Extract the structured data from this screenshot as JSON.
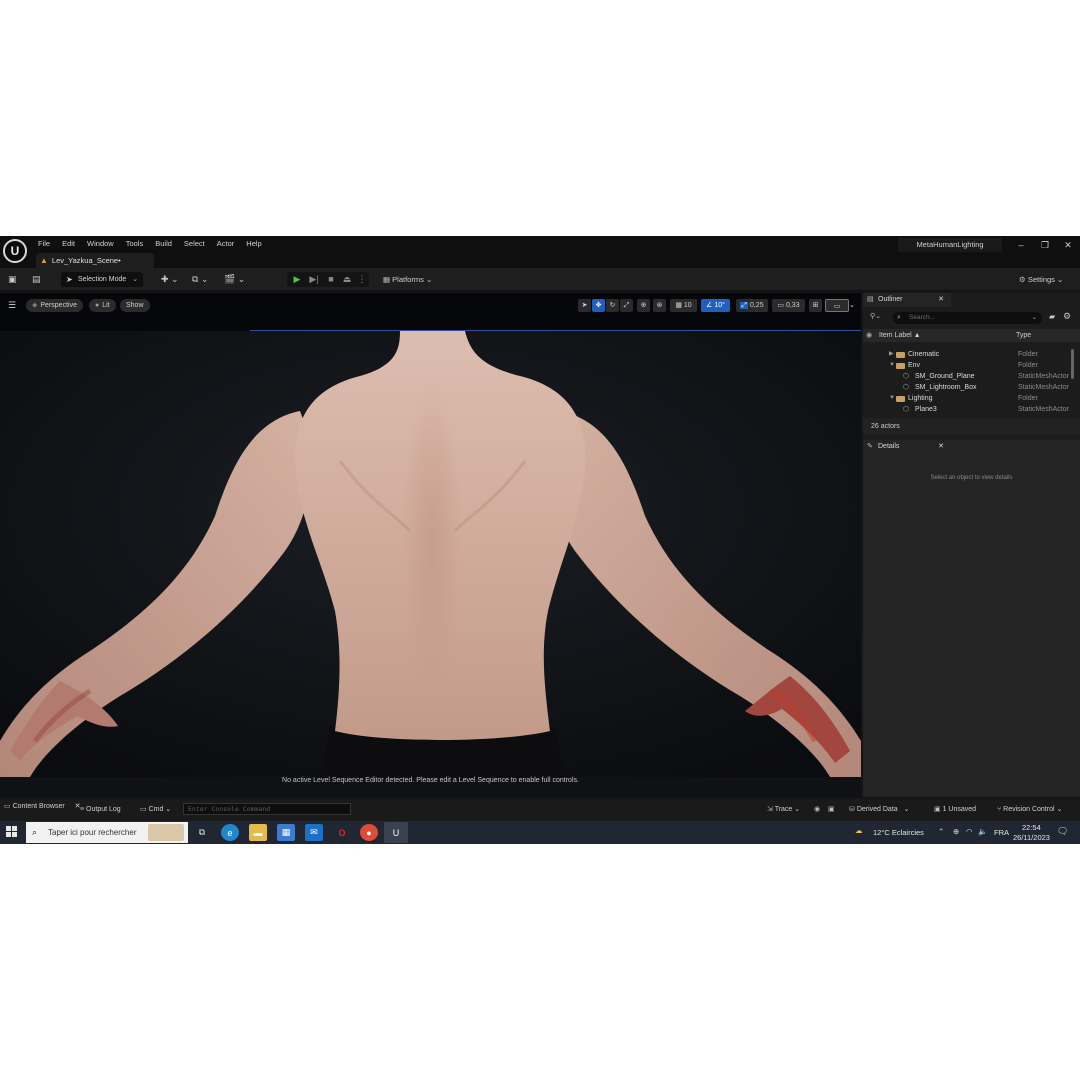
{
  "titlebar": {
    "menu": [
      "File",
      "Edit",
      "Window",
      "Tools",
      "Build",
      "Select",
      "Actor",
      "Help"
    ],
    "document_tab": "Lev_Yazkua_Scene•",
    "project": "MetaHumanLighting",
    "window_buttons": {
      "minimize": "–",
      "restore": "❐",
      "close": "✕"
    }
  },
  "toolbar": {
    "selection_mode": "Selection Mode",
    "platforms": "Platforms",
    "settings": "Settings"
  },
  "viewport": {
    "perspective": "Perspective",
    "lit": "Lit",
    "show": "Show",
    "grid_snap": "10",
    "rotation_snap": "10°",
    "scale_snap": "0,25",
    "camera_speed": "0,33",
    "notice": "No active Level Sequence Editor detected. Please edit a Level Sequence to enable full controls."
  },
  "outliner": {
    "tab": "Outliner",
    "search_placeholder": "Search...",
    "columns": {
      "label": "Item Label ▲",
      "type": "Type"
    },
    "rows": [
      {
        "label": "Cinematic",
        "type": "Folder",
        "kind": "folder",
        "expanded": false
      },
      {
        "label": "Env",
        "type": "Folder",
        "kind": "folder",
        "expanded": true
      },
      {
        "label": "SM_Ground_Plane",
        "type": "StaticMeshActor",
        "kind": "mesh"
      },
      {
        "label": "SM_Lightroom_Box",
        "type": "StaticMeshActor",
        "kind": "mesh"
      },
      {
        "label": "Lighting",
        "type": "Folder",
        "kind": "folder",
        "expanded": true
      },
      {
        "label": "Plane3",
        "type": "StaticMeshActor",
        "kind": "mesh"
      }
    ],
    "actor_count": "26 actors"
  },
  "details": {
    "tab": "Details",
    "empty_message": "Select an object to view details"
  },
  "statusbar": {
    "content_browser": "Content Browser",
    "output_log": "Output Log",
    "cmd": "Cmd",
    "console_placeholder": "Enter Console Command",
    "trace": "Trace",
    "derived_data": "Derived Data",
    "unsaved": "1 Unsaved",
    "revision_control": "Revision Control"
  },
  "taskbar": {
    "search_placeholder": "Taper ici pour rechercher",
    "weather": "12°C  Eclaircies",
    "language": "FRA",
    "time": "22:54",
    "date": "26/11/2023"
  }
}
